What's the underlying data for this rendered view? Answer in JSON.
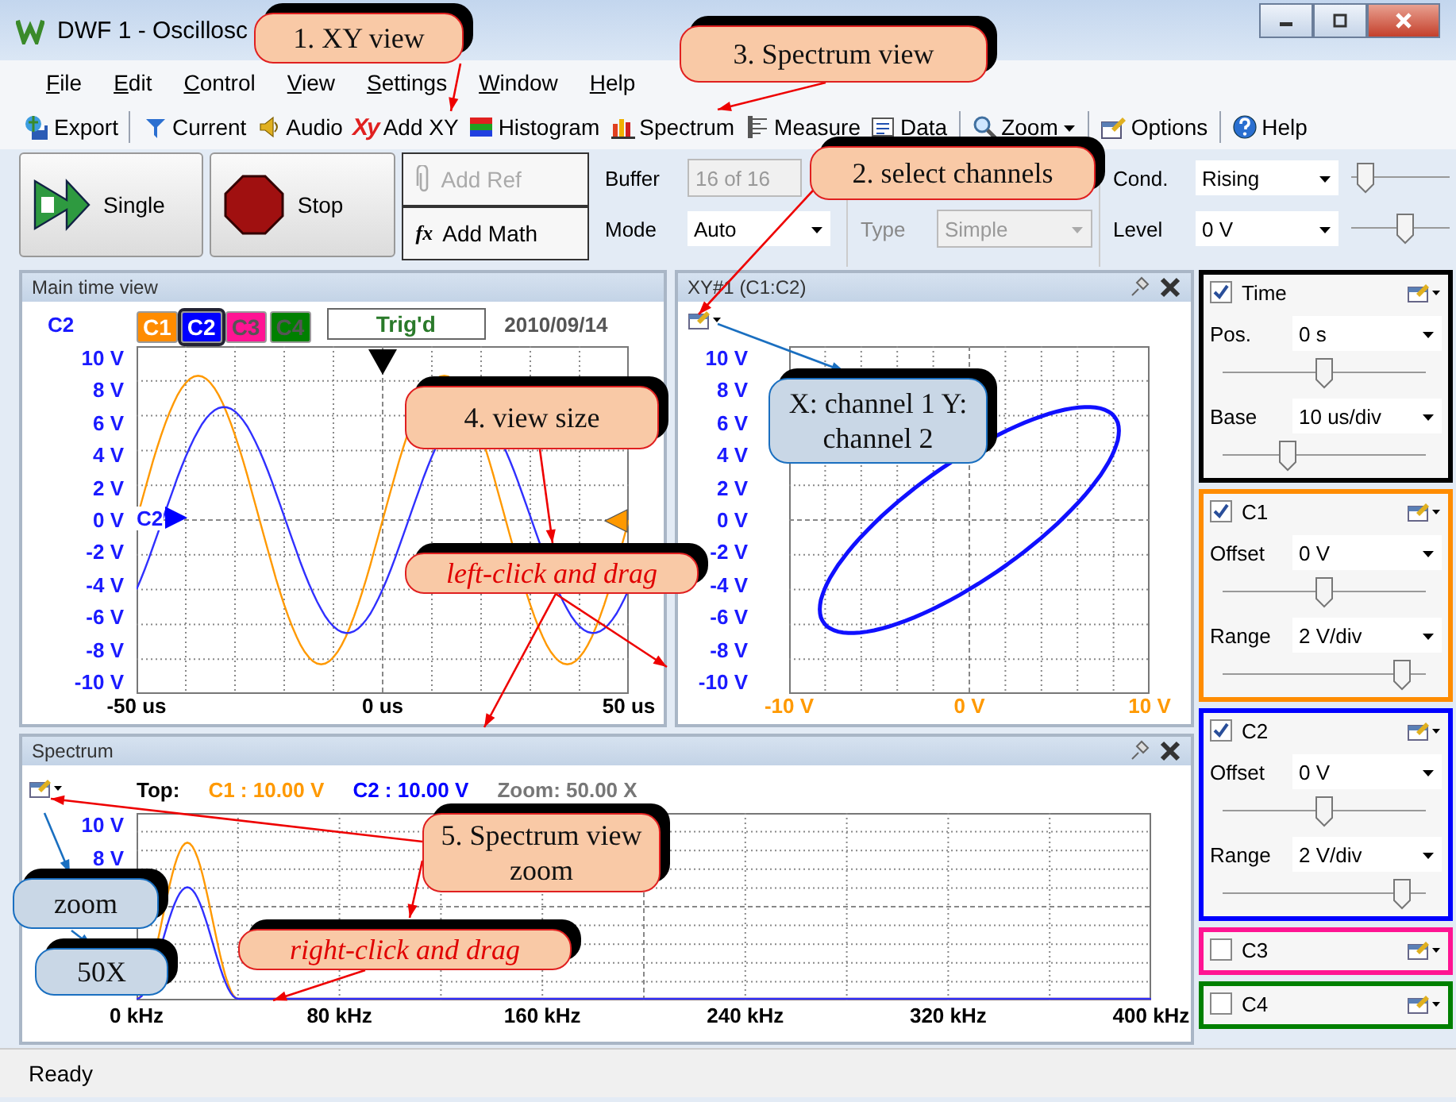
{
  "window": {
    "title": "DWF 1 - Oscillosc"
  },
  "menu": [
    {
      "label": "File"
    },
    {
      "label": "Edit"
    },
    {
      "label": "Control"
    },
    {
      "label": "View"
    },
    {
      "label": "Settings"
    },
    {
      "label": "Window"
    },
    {
      "label": "Help"
    }
  ],
  "toolbar": [
    {
      "label": "Export",
      "kind": "export",
      "group_end": true,
      "dropdown": false
    },
    {
      "label": "Current",
      "kind": "current",
      "group_end": false,
      "dropdown": false
    },
    {
      "label": "Audio",
      "kind": "audio",
      "group_end": false,
      "dropdown": false
    },
    {
      "label": "Add XY",
      "kind": "xy",
      "glyph": "Xy",
      "group_end": false,
      "dropdown": false
    },
    {
      "label": "Histogram",
      "kind": "histogram",
      "group_end": false,
      "dropdown": false
    },
    {
      "label": "Spectrum",
      "kind": "spectrum",
      "group_end": false,
      "dropdown": false
    },
    {
      "label": "Measure",
      "kind": "measure",
      "group_end": false,
      "dropdown": false
    },
    {
      "label": "Data",
      "kind": "data",
      "group_end": true,
      "dropdown": false
    },
    {
      "label": "Zoom",
      "kind": "zoom",
      "group_end": true,
      "dropdown": true
    },
    {
      "label": "Options",
      "kind": "options",
      "group_end": true,
      "dropdown": false
    },
    {
      "label": "Help",
      "kind": "help",
      "group_end": false,
      "dropdown": false
    }
  ],
  "acquisition": [
    {
      "label": "Single",
      "kind": "single"
    },
    {
      "label": "Stop",
      "kind": "stop"
    }
  ],
  "channel_buttons": [
    {
      "label": "Add Ref",
      "kind": "ref",
      "disabled": true
    },
    {
      "label": "Add Math",
      "kind": "math",
      "glyph": "fx",
      "disabled": false
    }
  ],
  "buffer": {
    "label": "Buffer",
    "value": "16 of 16",
    "disabled": true
  },
  "mode": {
    "label": "Mode",
    "value": "Auto",
    "disabled": false
  },
  "trigger_type": {
    "label": "Type",
    "value": "Simple",
    "disabled": true
  },
  "trigger": [
    {
      "label": "Cond.",
      "value": "Rising",
      "level": 0.05
    },
    {
      "label": "Level",
      "value": "0 V",
      "level": 0.55
    }
  ],
  "time_view": {
    "title": "Main time view",
    "channel_label": "C2",
    "channel_tabs": [
      {
        "label": "C1",
        "color": "#ff8c00",
        "enabled": true,
        "selected": false
      },
      {
        "label": "C2",
        "color": "#0000ff",
        "enabled": true,
        "selected": true
      },
      {
        "label": "C3",
        "color": "#ff1493",
        "enabled": false,
        "selected": false
      },
      {
        "label": "C4",
        "color": "#008000",
        "enabled": false,
        "selected": false
      }
    ],
    "trigger_status": "Trig'd",
    "date": "2010/09/14",
    "marker_label": "C2",
    "y_labels": [
      "10 V",
      "8 V",
      "6 V",
      "4 V",
      "2 V",
      "0 V",
      "-2 V",
      "-4 V",
      "-6 V",
      "-8 V",
      "-10 V"
    ],
    "x_labels": [
      "-50 us",
      "0 us",
      "50 us"
    ]
  },
  "xy_view": {
    "title": "XY#1 (C1:C2)",
    "y_labels": [
      "10 V",
      "8 V",
      "6 V",
      "4 V",
      "2 V",
      "0 V",
      "-2 V",
      "-4 V",
      "-6 V",
      "-8 V",
      "-10 V"
    ],
    "x_labels": [
      "-10 V",
      "0 V",
      "10 V"
    ]
  },
  "spectrum": {
    "title": "Spectrum",
    "top_label": "Top:",
    "readings": [
      {
        "text": "C1 : 10.00 V",
        "color": "#ff9900"
      },
      {
        "text": "C2 : 10.00 V",
        "color": "#0000ff"
      }
    ],
    "zoom": "Zoom: 50.00 X",
    "y_labels": [
      "10 V",
      "8 V"
    ],
    "x_labels": [
      "0 kHz",
      "80 kHz",
      "160 kHz",
      "240 kHz",
      "320 kHz",
      "400 kHz"
    ]
  },
  "side_panel": [
    {
      "label": "Time",
      "checked": true,
      "color": "#000000",
      "rows": [
        {
          "label": "Pos.",
          "value": "0 s",
          "level": 0.5
        },
        {
          "label": "Base",
          "value": "10 us/div",
          "level": 0.3
        }
      ]
    },
    {
      "label": "C1",
      "checked": true,
      "color": "#ff8c00",
      "rows": [
        {
          "label": "Offset",
          "value": "0 V",
          "level": 0.5
        },
        {
          "label": "Range",
          "value": "2 V/div",
          "level": 0.92
        }
      ]
    },
    {
      "label": "C2",
      "checked": true,
      "color": "#0000ff",
      "rows": [
        {
          "label": "Offset",
          "value": "0 V",
          "level": 0.5
        },
        {
          "label": "Range",
          "value": "2 V/div",
          "level": 0.92
        }
      ]
    },
    {
      "label": "C3",
      "checked": false,
      "color": "#ff1493"
    },
    {
      "label": "C4",
      "checked": false,
      "color": "#008000"
    }
  ],
  "status_bar": "Ready",
  "annotations": [
    {
      "text": "1. XY view",
      "kind": "orange",
      "italic": false
    },
    {
      "text": "3. Spectrum view",
      "kind": "orange",
      "italic": false
    },
    {
      "text": "2. select channels",
      "kind": "orange",
      "italic": false
    },
    {
      "text": "4. view size",
      "kind": "orange",
      "italic": false
    },
    {
      "text": "left-click and drag",
      "kind": "orange",
      "italic": true
    },
    {
      "text": "X: channel 1 Y: channel 2",
      "kind": "blue",
      "italic": false
    },
    {
      "text": "5. Spectrum view zoom",
      "kind": "orange",
      "italic": false
    },
    {
      "text": "right-click and drag",
      "kind": "orange",
      "italic": true
    },
    {
      "text": "zoom",
      "kind": "blue",
      "italic": false
    },
    {
      "text": "50X",
      "kind": "blue",
      "italic": false
    }
  ]
}
